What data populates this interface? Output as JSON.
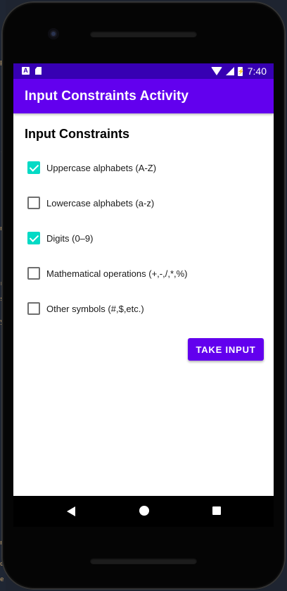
{
  "colors": {
    "status_bar": "#3700b3",
    "app_bar": "#6200ee",
    "checkbox_checked": "#03dac5",
    "button": "#6200ee"
  },
  "status_bar": {
    "time": "7:40",
    "icons": [
      "app-a-icon",
      "sd-card-icon",
      "wifi-icon",
      "cell-signal-icon",
      "battery-charging-icon"
    ]
  },
  "app_bar": {
    "title": "Input Constraints Activity"
  },
  "main": {
    "heading": "Input Constraints",
    "checkboxes": [
      {
        "label": "Uppercase alphabets (A-Z)",
        "checked": true
      },
      {
        "label": "Lowercase alphabets (a-z)",
        "checked": false
      },
      {
        "label": "Digits (0–9)",
        "checked": true
      },
      {
        "label": "Mathematical operations (+,-,/,*,%)",
        "checked": false
      },
      {
        "label": "Other symbols (#,$,etc.)",
        "checked": false
      }
    ],
    "take_input_label": "TAKE INPUT"
  },
  "nav_bar": {
    "buttons": [
      "back-icon",
      "home-icon",
      "recents-icon"
    ]
  }
}
